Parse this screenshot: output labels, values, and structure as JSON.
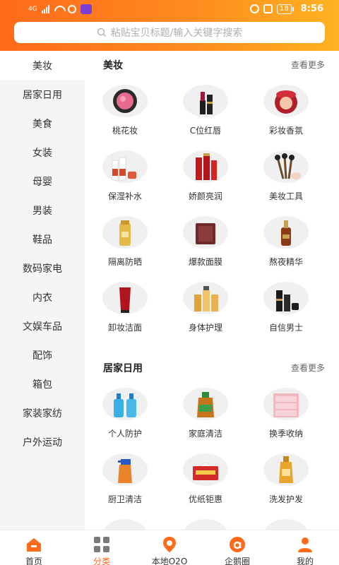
{
  "colors": {
    "accent": "#ff6a1a",
    "accent2": "#ffb321"
  },
  "status": {
    "network": "4G",
    "battery": "18",
    "time": "8:56"
  },
  "search": {
    "placeholder": "粘贴宝贝标题/输入关键字搜索"
  },
  "sidebar": {
    "active_index": 0,
    "items": [
      "美妆",
      "居家日用",
      "美食",
      "女装",
      "母婴",
      "男装",
      "鞋品",
      "数码家电",
      "内衣",
      "文娱车品",
      "配饰",
      "箱包",
      "家装家纺",
      "户外运动"
    ]
  },
  "sections": [
    {
      "title": "美妆",
      "more": "查看更多",
      "items": [
        {
          "label": "桃花妆",
          "icon": "blush-compact-icon"
        },
        {
          "label": "C位红唇",
          "icon": "lipstick-icon"
        },
        {
          "label": "彩妆香氛",
          "icon": "cushion-compact-icon"
        },
        {
          "label": "保湿补水",
          "icon": "skincare-set-icon"
        },
        {
          "label": "娇颜亮润",
          "icon": "red-bottles-icon"
        },
        {
          "label": "美妆工具",
          "icon": "makeup-brushes-icon"
        },
        {
          "label": "隔离防晒",
          "icon": "sunscreen-icon"
        },
        {
          "label": "爆款面膜",
          "icon": "face-mask-icon"
        },
        {
          "label": "熬夜精华",
          "icon": "serum-bottle-icon"
        },
        {
          "label": "卸妆洁面",
          "icon": "cleanser-tube-icon"
        },
        {
          "label": "身体护理",
          "icon": "body-lotion-icon"
        },
        {
          "label": "自信男士",
          "icon": "mens-skincare-icon"
        }
      ]
    },
    {
      "title": "居家日用",
      "more": "查看更多",
      "items": [
        {
          "label": "个人防护",
          "icon": "hand-sanitizer-icon"
        },
        {
          "label": "家庭清洁",
          "icon": "disinfectant-icon"
        },
        {
          "label": "换季收纳",
          "icon": "storage-drawer-icon"
        },
        {
          "label": "厨卫清洁",
          "icon": "spray-cleaner-icon"
        },
        {
          "label": "优纸钜惠",
          "icon": "tissue-box-icon"
        },
        {
          "label": "洗发护发",
          "icon": "shampoo-icon"
        },
        {
          "label": "",
          "icon": "product-icon"
        },
        {
          "label": "",
          "icon": "product-icon"
        },
        {
          "label": "",
          "icon": "product-icon"
        }
      ]
    }
  ],
  "tabs": [
    {
      "label": "首页",
      "icon": "home-icon"
    },
    {
      "label": "分类",
      "icon": "category-grid-icon"
    },
    {
      "label": "本地O2O",
      "icon": "location-pin-icon"
    },
    {
      "label": "企鹅圈",
      "icon": "circle-a-icon"
    },
    {
      "label": "我的",
      "icon": "profile-icon"
    }
  ],
  "active_tab": 1
}
